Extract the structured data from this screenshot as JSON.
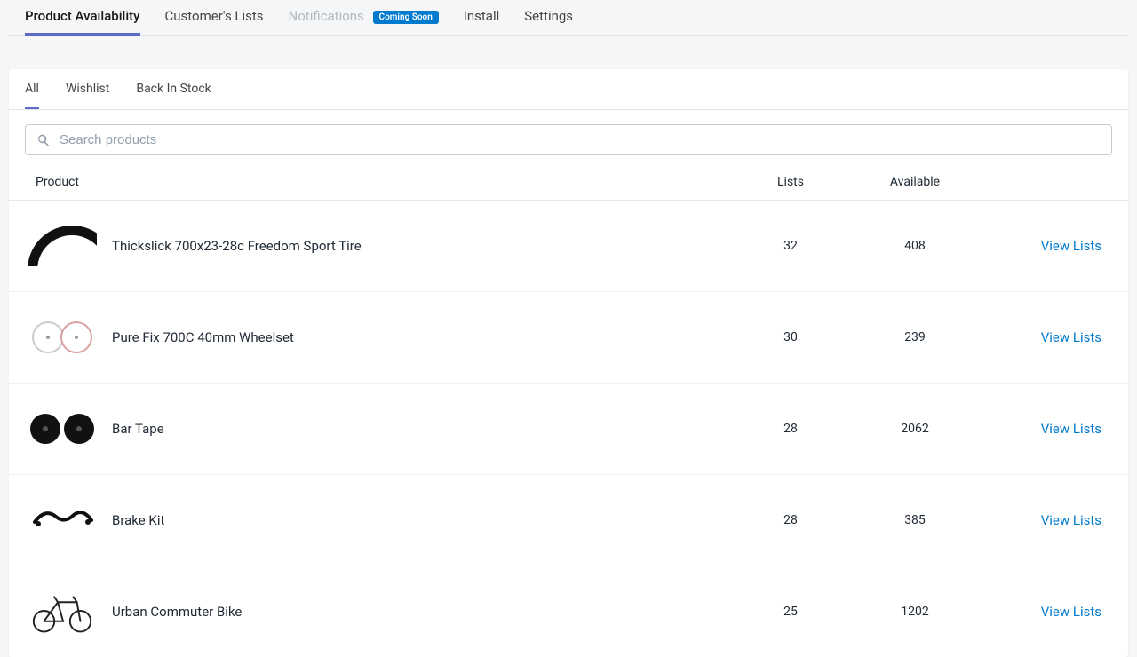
{
  "nav": {
    "items": [
      {
        "label": "Product Availability",
        "active": true
      },
      {
        "label": "Customer's Lists"
      },
      {
        "label": "Notifications",
        "disabled": true,
        "badge": "Coming Soon"
      },
      {
        "label": "Install"
      },
      {
        "label": "Settings"
      }
    ]
  },
  "subtabs": [
    {
      "label": "All",
      "active": true
    },
    {
      "label": "Wishlist"
    },
    {
      "label": "Back In Stock"
    }
  ],
  "search": {
    "placeholder": "Search products"
  },
  "table": {
    "headers": {
      "product": "Product",
      "lists": "Lists",
      "available": "Available"
    },
    "action_label": "View Lists",
    "rows": [
      {
        "name": "Thickslick 700x23-28c Freedom Sport Tire",
        "lists": "32",
        "available": "408",
        "icon": "tire"
      },
      {
        "name": "Pure Fix 700C 40mm Wheelset",
        "lists": "30",
        "available": "239",
        "icon": "wheelset"
      },
      {
        "name": "Bar Tape",
        "lists": "28",
        "available": "2062",
        "icon": "bartape"
      },
      {
        "name": "Brake Kit",
        "lists": "28",
        "available": "385",
        "icon": "brakekit"
      },
      {
        "name": "Urban Commuter Bike",
        "lists": "25",
        "available": "1202",
        "icon": "bike"
      }
    ]
  }
}
